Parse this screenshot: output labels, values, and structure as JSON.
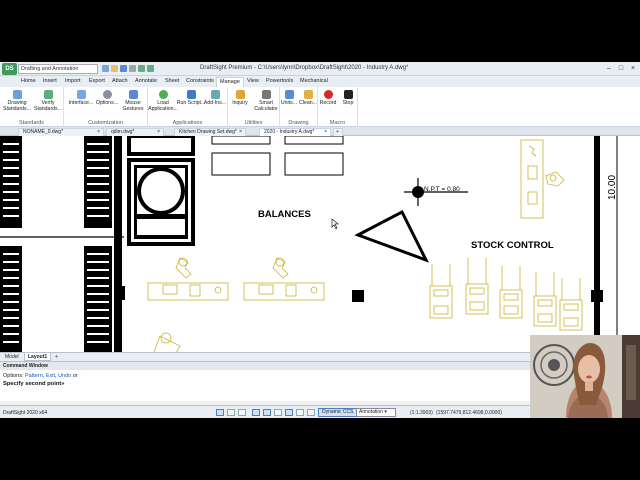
{
  "app": {
    "workspace": "Drafting and Annotation",
    "title": "DraftSight Premium - C:\\Users\\lynn\\Dropbox\\DraftSight\\2020 - Industry A.dwg*",
    "logo_text": "DS"
  },
  "ribbon_tabs": [
    "Home",
    "Insert",
    "Import",
    "Export",
    "Attach",
    "Annotate",
    "Sheet",
    "Constraints",
    "Manage",
    "View",
    "Powertools",
    "Mechanical"
  ],
  "active_ribbon_tab": "Manage",
  "ribbon_groups": {
    "standards": {
      "label": "Standards",
      "buttons": [
        "Drawing Standards...",
        "Verify Standards..."
      ]
    },
    "customization": {
      "label": "Customization",
      "buttons": [
        "Interface...",
        "Options...",
        "Mouse Gestures"
      ]
    },
    "applications": {
      "label": "Applications",
      "buttons": [
        "Load Application...",
        "Run Script...",
        "Add-Ins..."
      ]
    },
    "utilities": {
      "label": "Utilities",
      "buttons": [
        "Inquiry",
        "Smart Calculator"
      ]
    },
    "drawing": {
      "label": "Drawing",
      "buttons": [
        "Units...",
        "Clean..."
      ]
    },
    "macro": {
      "label": "Macro",
      "buttons": [
        "Record",
        "Stop"
      ]
    }
  },
  "doc_tabs": [
    "NONAME_0.dwg*",
    "qdim.dwg*",
    "Kitchen Drawing Set.dwg*",
    "2020 - Industry A.dwg*"
  ],
  "active_doc_tab": "2020 - Industry A.dwg*",
  "drawing": {
    "balances_label": "BALANCES",
    "stock_control_label": "STOCK CONTROL",
    "npt_label": "N.P.T = 0.80",
    "dimension_label": "10.00"
  },
  "layout_tabs": [
    "Model",
    "Layout1"
  ],
  "active_layout_tab": "Layout1",
  "command_window": {
    "title": "Command Window",
    "options_prefix": "Options:",
    "options": [
      "Pattern",
      "Exit",
      "Undo"
    ],
    "options_suffix": "or",
    "prompt": "Specify second point»"
  },
  "status_bar": {
    "version": "DraftSight 2020 x64",
    "dynamic_ccs": "Dynamic CCS",
    "annotation": "Annotation",
    "scale": "(1:1.3903)",
    "coordinates": "(1597.7479,812.4698,0.0000)"
  },
  "colors": {
    "accent": "#4a7fc0",
    "drawing_yellow": "#c9b234",
    "title_bar": "#e9eef5"
  }
}
